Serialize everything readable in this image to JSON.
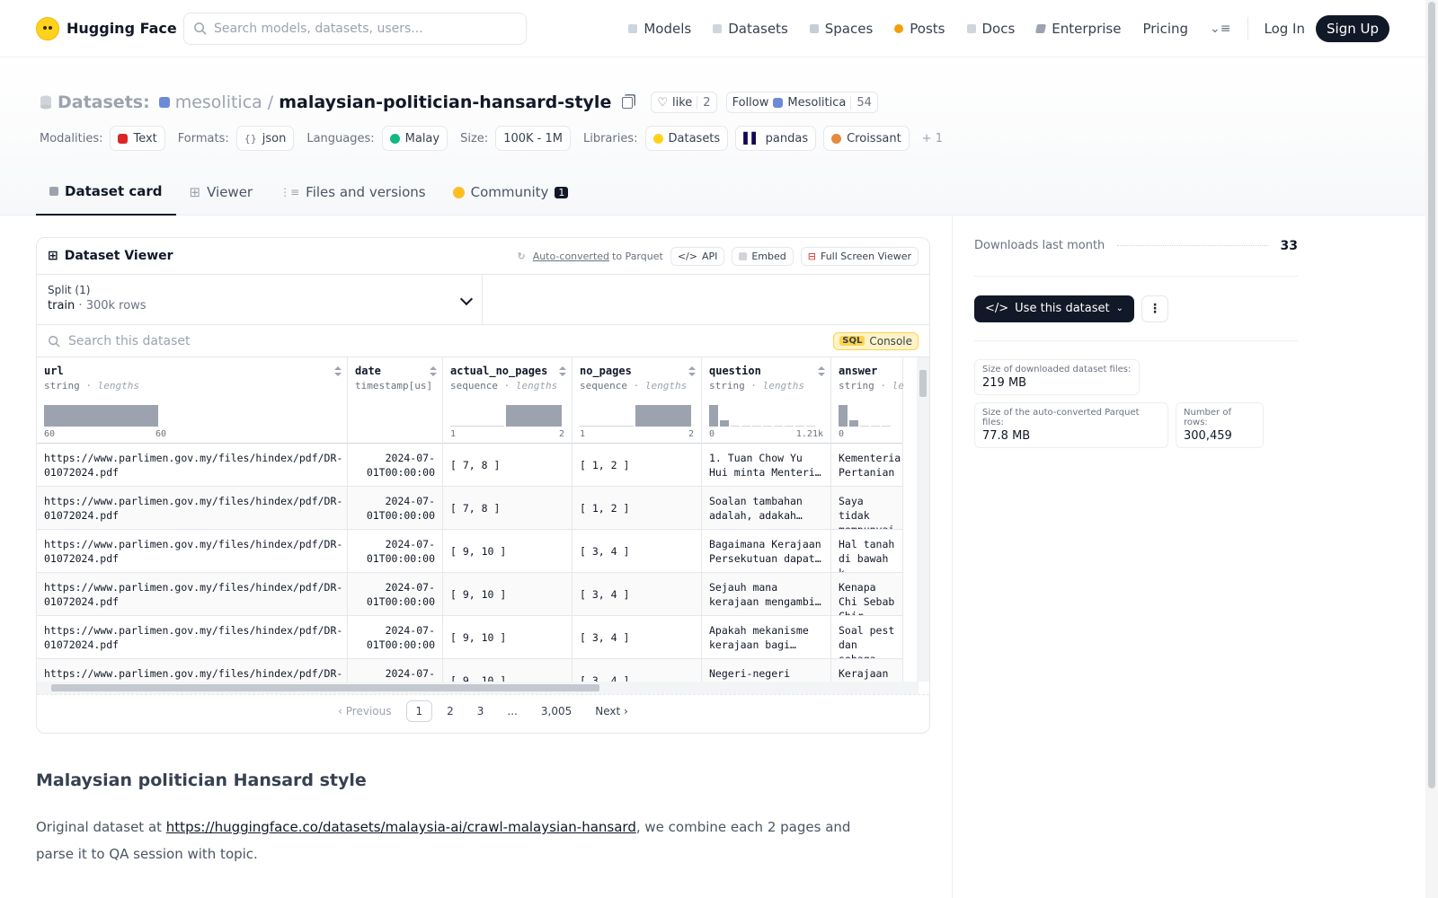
{
  "header": {
    "brand": "Hugging Face",
    "search_placeholder": "Search models, datasets, users...",
    "nav": [
      "Models",
      "Datasets",
      "Spaces",
      "Posts",
      "Docs",
      "Enterprise",
      "Pricing"
    ],
    "login": "Log In",
    "signup": "Sign Up"
  },
  "repo": {
    "type_label": "Datasets:",
    "org": "mesolitica",
    "sep": "/",
    "name": "malaysian-politician-hansard-style",
    "like_label": "like",
    "like_count": "2",
    "follow_label": "Follow",
    "follow_org": "Mesolitica",
    "follow_count": "54"
  },
  "meta": {
    "modalities_key": "Modalities:",
    "modalities": "Text",
    "formats_key": "Formats:",
    "formats": "json",
    "languages_key": "Languages:",
    "languages": "Malay",
    "size_key": "Size:",
    "size": "100K - 1M",
    "libraries_key": "Libraries:",
    "libraries": [
      "Datasets",
      "pandas",
      "Croissant"
    ],
    "libraries_more": "+ 1"
  },
  "tabs": {
    "card": "Dataset card",
    "viewer": "Viewer",
    "files": "Files and versions",
    "community": "Community",
    "community_count": "1"
  },
  "viewer": {
    "title": "Dataset Viewer",
    "auto_converted": "Auto-converted",
    "to_parquet": "to Parquet",
    "api": "API",
    "embed": "Embed",
    "full_screen": "Full Screen Viewer",
    "split_label": "Split (1)",
    "split_name": "train",
    "split_dot": "·",
    "split_rows": "300k rows",
    "search_placeholder": "Search this dataset",
    "sql_tag": "SQL",
    "sql_label": "Console",
    "columns": [
      {
        "name": "url",
        "type": "string",
        "sub": "· lengths",
        "min": "60",
        "max": "60"
      },
      {
        "name": "date",
        "type": "timestamp[us]",
        "sub": "",
        "min": "",
        "max": ""
      },
      {
        "name": "actual_no_pages",
        "type": "sequence",
        "sub": "· lengths",
        "min": "1",
        "max": "2"
      },
      {
        "name": "no_pages",
        "type": "sequence",
        "sub": "· lengths",
        "min": "1",
        "max": "2"
      },
      {
        "name": "question",
        "type": "string",
        "sub": "· lengths",
        "min": "0",
        "max": "1.21k"
      },
      {
        "name": "answer",
        "type": "string",
        "sub": "· le",
        "min": "0",
        "max": ""
      }
    ],
    "rows": [
      {
        "url": "https://www.parlimen.gov.my/files/hindex/pdf/DR-01072024.pdf",
        "date_a": "2024-07-",
        "date_b": "01T00:00:00",
        "actual": "[ 7, 8 ]",
        "pages": "[ 1, 2 ]",
        "q": "1. Tuan Chow Yu Hui minta Menteri…",
        "a": "Kementeria Pertanian"
      },
      {
        "url": "https://www.parlimen.gov.my/files/hindex/pdf/DR-01072024.pdf",
        "date_a": "2024-07-",
        "date_b": "01T00:00:00",
        "actual": "[ 7, 8 ]",
        "pages": "[ 1, 2 ]",
        "q": "Soalan tambahan adalah, adakah…",
        "a": "Saya tidak mempunyai"
      },
      {
        "url": "https://www.parlimen.gov.my/files/hindex/pdf/DR-01072024.pdf",
        "date_a": "2024-07-",
        "date_b": "01T00:00:00",
        "actual": "[ 9, 10 ]",
        "pages": "[ 3, 4 ]",
        "q": "Bagaimana Kerajaan Persekutuan dapat…",
        "a": "Hal tanah di bawah k"
      },
      {
        "url": "https://www.parlimen.gov.my/files/hindex/pdf/DR-01072024.pdf",
        "date_a": "2024-07-",
        "date_b": "01T00:00:00",
        "actual": "[ 9, 10 ]",
        "pages": "[ 3, 4 ]",
        "q": "Sejauh mana kerajaan mengambi…",
        "a": "Kenapa Chi Sebab Chir"
      },
      {
        "url": "https://www.parlimen.gov.my/files/hindex/pdf/DR-01072024.pdf",
        "date_a": "2024-07-",
        "date_b": "01T00:00:00",
        "actual": "[ 9, 10 ]",
        "pages": "[ 3, 4 ]",
        "q": "Apakah mekanisme kerajaan bagi…",
        "a": "Soal pest dan sebaga"
      },
      {
        "url": "https://www.parlimen.gov.my/files/hindex/pdf/DR-",
        "date_a": "2024-07-",
        "date_b": "",
        "actual": "[ 9, 10 ]",
        "pages": "[ 3, 4 ]",
        "q": "Negeri-negeri",
        "a": "Kerajaan t"
      }
    ],
    "pager": {
      "prev": "Previous",
      "pages": [
        "1",
        "2",
        "3",
        "...",
        "3,005"
      ],
      "next": "Next"
    }
  },
  "readme": {
    "heading": "Malaysian politician Hansard style",
    "prefix": "Original dataset at ",
    "link": "https://huggingface.co/datasets/malaysia-ai/crawl-malaysian-hansard",
    "suffix": ", we combine each 2 pages and parse it to QA session with topic."
  },
  "sidebar": {
    "downloads_label": "Downloads last month",
    "downloads_value": "33",
    "use_button": "Use this dataset",
    "stats": [
      {
        "k": "Size of downloaded dataset files:",
        "v": "219 MB"
      },
      {
        "k": "Size of the auto-converted Parquet files:",
        "v": "77.8 MB"
      },
      {
        "k": "Number of rows:",
        "v": "300,459"
      }
    ]
  },
  "colors": {
    "brand_yellow": "#ffd21e",
    "dark": "#111827",
    "muted": "#6b7280"
  }
}
